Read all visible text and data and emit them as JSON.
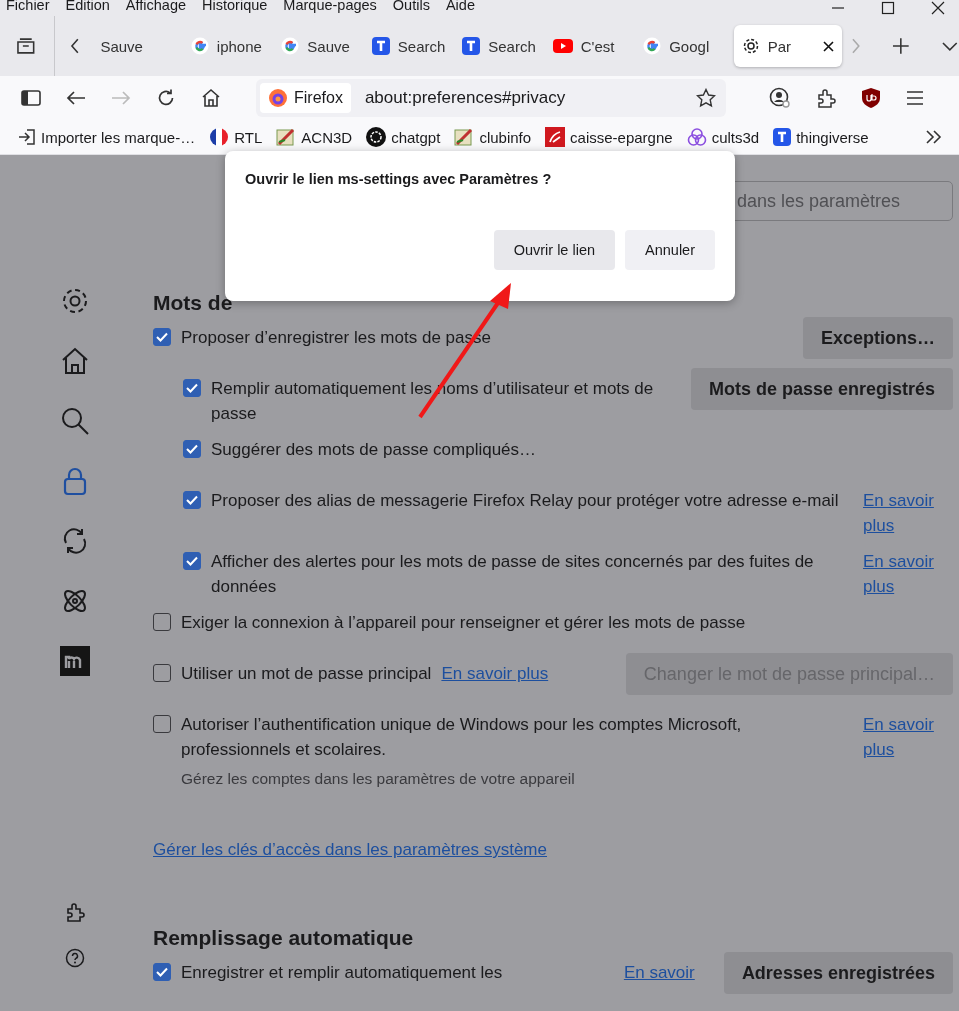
{
  "menu": [
    "Fichier",
    "Edition",
    "Affichage",
    "Historique",
    "Marque-pages",
    "Outils",
    "Aide"
  ],
  "tabs": [
    {
      "label": "Sauve",
      "kind": "none",
      "selected": false
    },
    {
      "label": "iphone",
      "kind": "google",
      "selected": false
    },
    {
      "label": "Sauve",
      "kind": "google",
      "selected": false
    },
    {
      "label": "Search",
      "kind": "t",
      "selected": false
    },
    {
      "label": "Search",
      "kind": "t",
      "selected": false
    },
    {
      "label": "C'est",
      "kind": "youtube",
      "selected": false
    },
    {
      "label": "Googl",
      "kind": "google",
      "selected": false
    },
    {
      "label": "Par",
      "kind": "gear",
      "selected": true
    }
  ],
  "address": {
    "identity": "Firefox",
    "url": "about:preferences#privacy"
  },
  "bookmarks": [
    {
      "label": "Importer les marque-…",
      "kind": "import"
    },
    {
      "label": "RTL",
      "kind": "flag"
    },
    {
      "label": "ACN3D",
      "kind": "pencil"
    },
    {
      "label": "chatgpt",
      "kind": "chatgpt"
    },
    {
      "label": "clubinfo",
      "kind": "pencil"
    },
    {
      "label": "caisse-epargne",
      "kind": "caisse"
    },
    {
      "label": "cults3d",
      "kind": "cults"
    },
    {
      "label": "thingiverse",
      "kind": "t"
    }
  ],
  "search": {
    "placeholder": "dans les paramètres"
  },
  "sidebar": [
    {
      "kind": "gear",
      "selected": false
    },
    {
      "kind": "home",
      "selected": false
    },
    {
      "kind": "search",
      "selected": false
    },
    {
      "kind": "lock",
      "selected": true
    },
    {
      "kind": "sync",
      "selected": false
    },
    {
      "kind": "atom",
      "selected": false
    },
    {
      "kind": "m",
      "selected": false
    }
  ],
  "sidebar_bottom": [
    {
      "kind": "puzzle"
    },
    {
      "kind": "help"
    }
  ],
  "section_1": {
    "heading": "Mots de",
    "settings": [
      {
        "label": "Proposer d’enregistrer les mots de passe",
        "checked": true,
        "button": {
          "label": "Exceptions…",
          "disabled": false
        },
        "children": [
          {
            "label": "Remplir automatiquement les noms d’utilisateur et mots de passe",
            "checked": true,
            "button": {
              "label": "Mots de passe enregistrés",
              "disabled": false
            }
          },
          {
            "label": "Suggérer des mots de passe compliqués…",
            "checked": true
          },
          {
            "label": "Proposer des alias de messagerie Firefox Relay pour protéger votre adresse e-mail",
            "checked": true,
            "link": "En savoir plus"
          },
          {
            "label": "Afficher des alertes pour les mots de passe de sites concernés par des fuites de données",
            "checked": true,
            "link": "En savoir plus"
          }
        ]
      },
      {
        "label": "Exiger la connexion à l’appareil pour renseigner et gérer les mots de passe",
        "checked": false
      },
      {
        "label": "Utiliser un mot de passe principal",
        "checked": false,
        "inline_link": "En savoir plus",
        "button": {
          "label": "Changer le mot de passe principal…",
          "disabled": true
        }
      },
      {
        "label": "Autoriser l’authentification unique de Windows pour les comptes Microsoft, professionnels et scolaires.",
        "checked": false,
        "link": "En savoir plus",
        "note": "Gérez les comptes dans les paramètres de votre appareil"
      }
    ],
    "link": "Gérer les clés d’accès dans les paramètres système"
  },
  "section_2": {
    "heading": "Remplissage automatique",
    "settings": [
      {
        "label": "Enregistrer et remplir automatiquement les",
        "checked": true,
        "link": "En savoir",
        "button": {
          "label": "Adresses enregistrées",
          "disabled": false
        }
      }
    ]
  },
  "dialog": {
    "title": "Ouvrir le lien ms-settings avec Paramètres ?",
    "buttons": [
      {
        "label": "Ouvrir le lien",
        "kind": "primary"
      },
      {
        "label": "Annuler",
        "kind": "cancel"
      }
    ]
  }
}
